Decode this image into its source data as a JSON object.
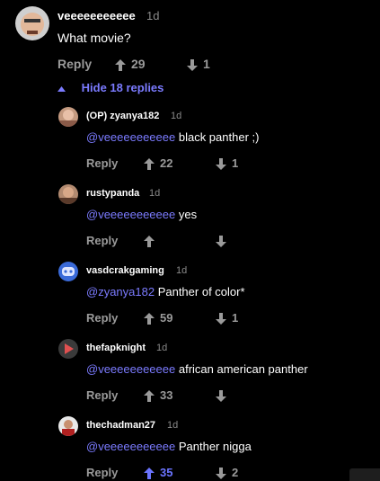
{
  "top": {
    "username": "veeeeeeeeeee",
    "time": "1d",
    "text": "What movie?",
    "reply_label": "Reply",
    "upvotes": "29",
    "downvotes": "1"
  },
  "hide_replies": "Hide 18 replies",
  "replies": [
    {
      "username": "(OP) zyanya182",
      "time": "1d",
      "mention": "@veeeeeeeeeee",
      "text": " black panther ;)",
      "reply_label": "Reply",
      "upvotes": "22",
      "downvotes": "1"
    },
    {
      "username": "rustypanda",
      "time": "1d",
      "mention": "@veeeeeeeeeee",
      "text": " yes",
      "reply_label": "Reply",
      "upvotes": "",
      "downvotes": ""
    },
    {
      "username": "vasdcrakgaming",
      "time": "1d",
      "mention": "@zyanya182",
      "text": " Panther of color*",
      "reply_label": "Reply",
      "upvotes": "59",
      "downvotes": "1"
    },
    {
      "username": "thefapknight",
      "time": "1d",
      "mention": "@veeeeeeeeeee",
      "text": " african american panther",
      "reply_label": "Reply",
      "upvotes": "33",
      "downvotes": ""
    },
    {
      "username": "thechadman27",
      "time": "1d",
      "mention": "@veeeeeeeeeee",
      "text": " Panther nigga",
      "reply_label": "Reply",
      "upvotes": "35",
      "downvotes": "2"
    }
  ],
  "colors": {
    "accent": "#7b7bff",
    "upvoted": "#6b74ff",
    "muted": "#9a9a9a"
  }
}
